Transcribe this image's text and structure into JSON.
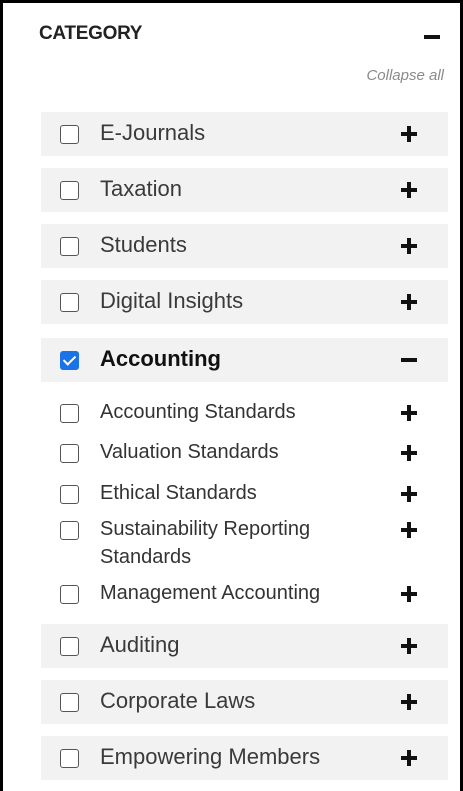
{
  "header": {
    "title": "CATEGORY",
    "collapse_all": "Collapse all"
  },
  "categories_before": [
    {
      "label": "E-Journals",
      "checked": false,
      "expanded": false
    },
    {
      "label": "Taxation",
      "checked": false,
      "expanded": false
    },
    {
      "label": "Students",
      "checked": false,
      "expanded": false
    },
    {
      "label": "Digital Insights",
      "checked": false,
      "expanded": false
    },
    {
      "label": "Accounting",
      "checked": true,
      "expanded": true
    }
  ],
  "accounting_subcategories": [
    {
      "label": "Accounting Standards",
      "checked": false
    },
    {
      "label": "Valuation Standards",
      "checked": false
    },
    {
      "label": "Ethical Standards",
      "checked": false
    },
    {
      "label": "Sustainability Reporting Standards",
      "checked": false
    },
    {
      "label": "Management Accounting",
      "checked": false
    }
  ],
  "categories_after": [
    {
      "label": "Auditing",
      "checked": false,
      "expanded": false
    },
    {
      "label": "Corporate Laws",
      "checked": false,
      "expanded": false
    },
    {
      "label": "Empowering Members",
      "checked": false,
      "expanded": false
    }
  ],
  "colors": {
    "row_background": "#f2f2f2",
    "checkbox_checked": "#1a73e8",
    "collapse_all_text": "#8a8a8a"
  }
}
